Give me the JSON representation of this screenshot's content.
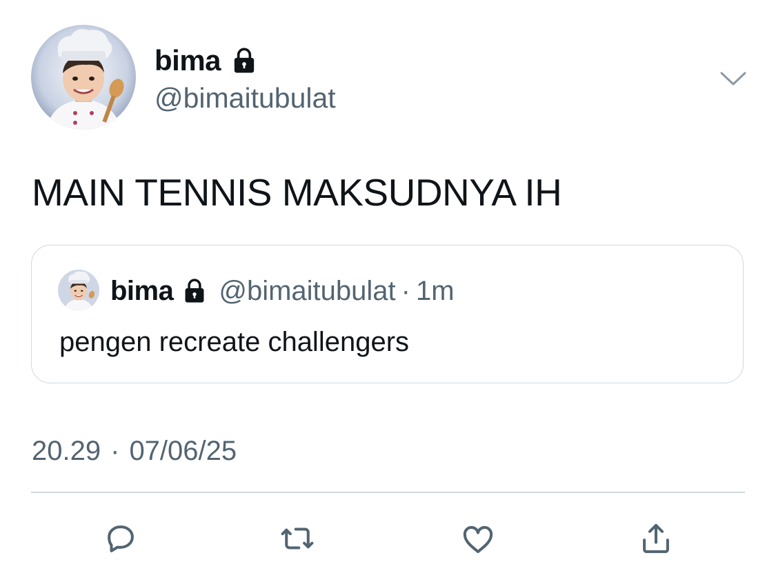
{
  "author": {
    "display_name": "bima",
    "handle": "@bimaitubulat",
    "avatar_icon": "chef-avatar",
    "lock_icon": "lock-icon"
  },
  "tweet": {
    "text": "MAIN TENNIS MAKSUDNYA IH",
    "time": "20.29",
    "separator": "·",
    "date": "07/06/25"
  },
  "quoted_tweet": {
    "display_name": "bima",
    "handle": "@bimaitubulat",
    "separator": "·",
    "time_ago": "1m",
    "text": "pengen recreate challengers"
  },
  "actions": [
    {
      "name": "reply",
      "icon": "reply-icon"
    },
    {
      "name": "retweet",
      "icon": "retweet-icon"
    },
    {
      "name": "like",
      "icon": "heart-icon"
    },
    {
      "name": "share",
      "icon": "share-icon"
    }
  ],
  "colors": {
    "text_primary": "#0f1419",
    "text_secondary": "#536471",
    "border": "#cfd9de",
    "icon": "#536471"
  }
}
